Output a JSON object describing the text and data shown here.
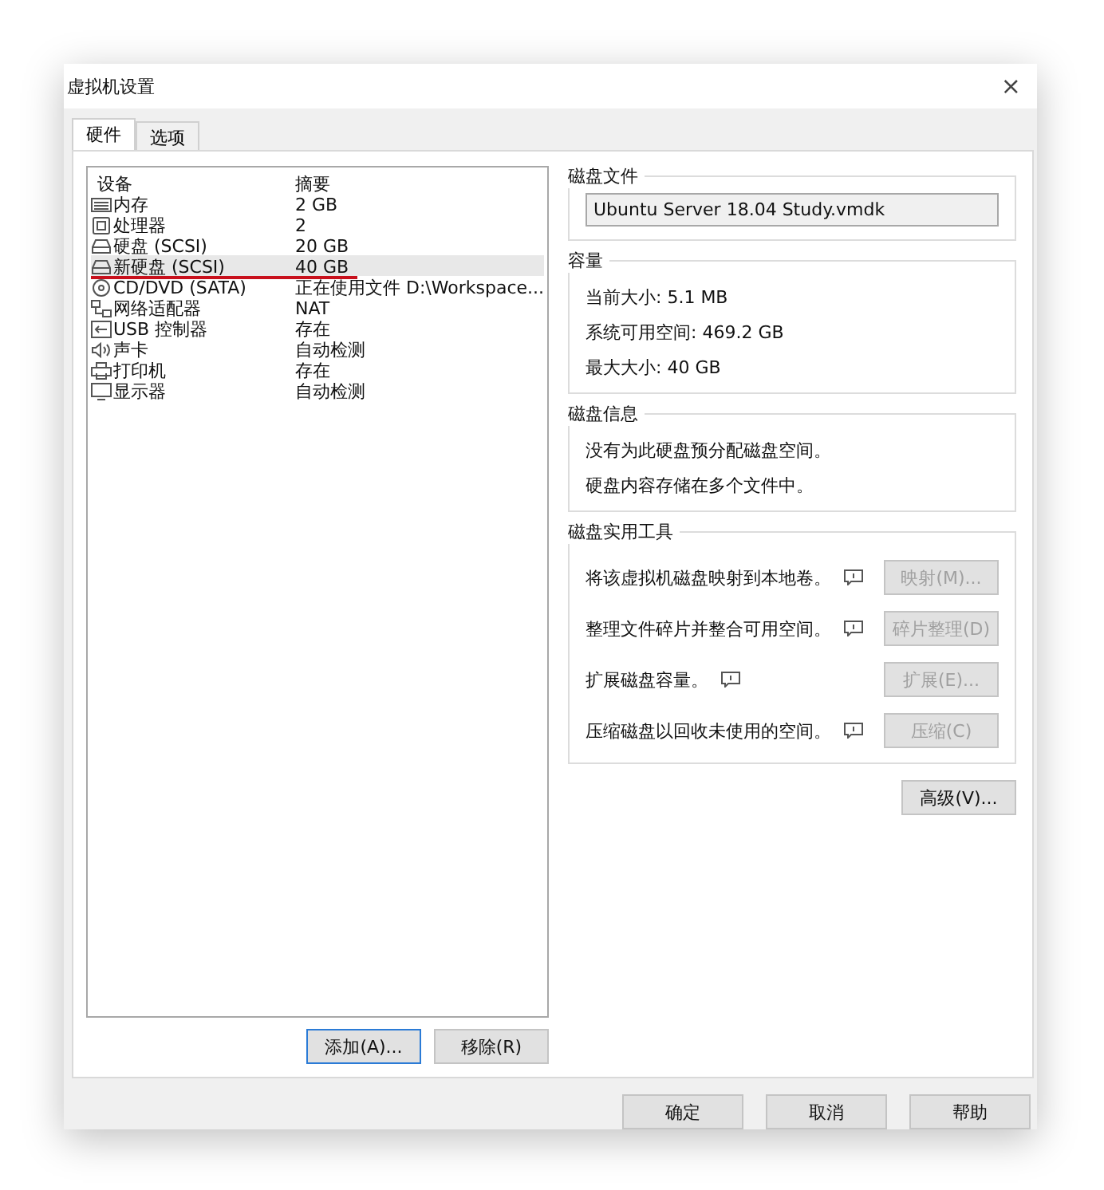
{
  "window": {
    "title": "虚拟机设置",
    "close": "×"
  },
  "tabs": [
    {
      "label": "硬件",
      "selected": true
    },
    {
      "label": "选项",
      "selected": false
    }
  ],
  "device_list": {
    "columns": [
      "设备",
      "摘要"
    ],
    "rows": [
      {
        "kind": "memory",
        "device": "内存",
        "summary": "2 GB",
        "selected": false,
        "underlined": false
      },
      {
        "kind": "cpu",
        "device": "处理器",
        "summary": "2",
        "selected": false,
        "underlined": false
      },
      {
        "kind": "disk",
        "device": "硬盘 (SCSI)",
        "summary": "20 GB",
        "selected": false,
        "underlined": false
      },
      {
        "kind": "disk",
        "device": "新硬盘 (SCSI)",
        "summary": "40 GB",
        "selected": true,
        "underlined": true
      },
      {
        "kind": "cdrom",
        "device": "CD/DVD (SATA)",
        "summary": "正在使用文件 D:\\Workspace...",
        "selected": false,
        "underlined": false
      },
      {
        "kind": "network",
        "device": "网络适配器",
        "summary": "NAT",
        "selected": false,
        "underlined": false
      },
      {
        "kind": "usb",
        "device": "USB 控制器",
        "summary": "存在",
        "selected": false,
        "underlined": false
      },
      {
        "kind": "sound",
        "device": "声卡",
        "summary": "自动检测",
        "selected": false,
        "underlined": false
      },
      {
        "kind": "printer",
        "device": "打印机",
        "summary": "存在",
        "selected": false,
        "underlined": false
      },
      {
        "kind": "display",
        "device": "显示器",
        "summary": "自动检测",
        "selected": false,
        "underlined": false
      }
    ]
  },
  "list_buttons": [
    {
      "label": "添加(A)...",
      "disabled": false
    },
    {
      "label": "移除(R)",
      "disabled": false
    }
  ],
  "disk_file": {
    "title": "磁盘文件",
    "value": "Ubuntu Server 18.04 Study.vmdk"
  },
  "capacity": {
    "title": "容量",
    "lines": [
      "当前大小: 5.1 MB",
      "系统可用空间: 469.2 GB",
      "最大大小: 40 GB"
    ]
  },
  "disk_info": {
    "title": "磁盘信息",
    "lines": [
      "没有为此硬盘预分配磁盘空间。",
      "硬盘内容存储在多个文件中。"
    ]
  },
  "disk_utilities": {
    "title": "磁盘实用工具",
    "rows": [
      {
        "text": "将该虚拟机磁盘映射到本地卷。",
        "button": "映射(M)...",
        "disabled": true
      },
      {
        "text": "整理文件碎片并整合可用空间。",
        "button": "碎片整理(D)",
        "disabled": true
      },
      {
        "text": "扩展磁盘容量。",
        "button": "扩展(E)...",
        "disabled": true
      },
      {
        "text": "压缩磁盘以回收未使用的空间。",
        "button": "压缩(C)",
        "disabled": true
      }
    ]
  },
  "advanced_button": "高级(V)...",
  "footer_buttons": [
    "确定",
    "取消",
    "帮助"
  ]
}
